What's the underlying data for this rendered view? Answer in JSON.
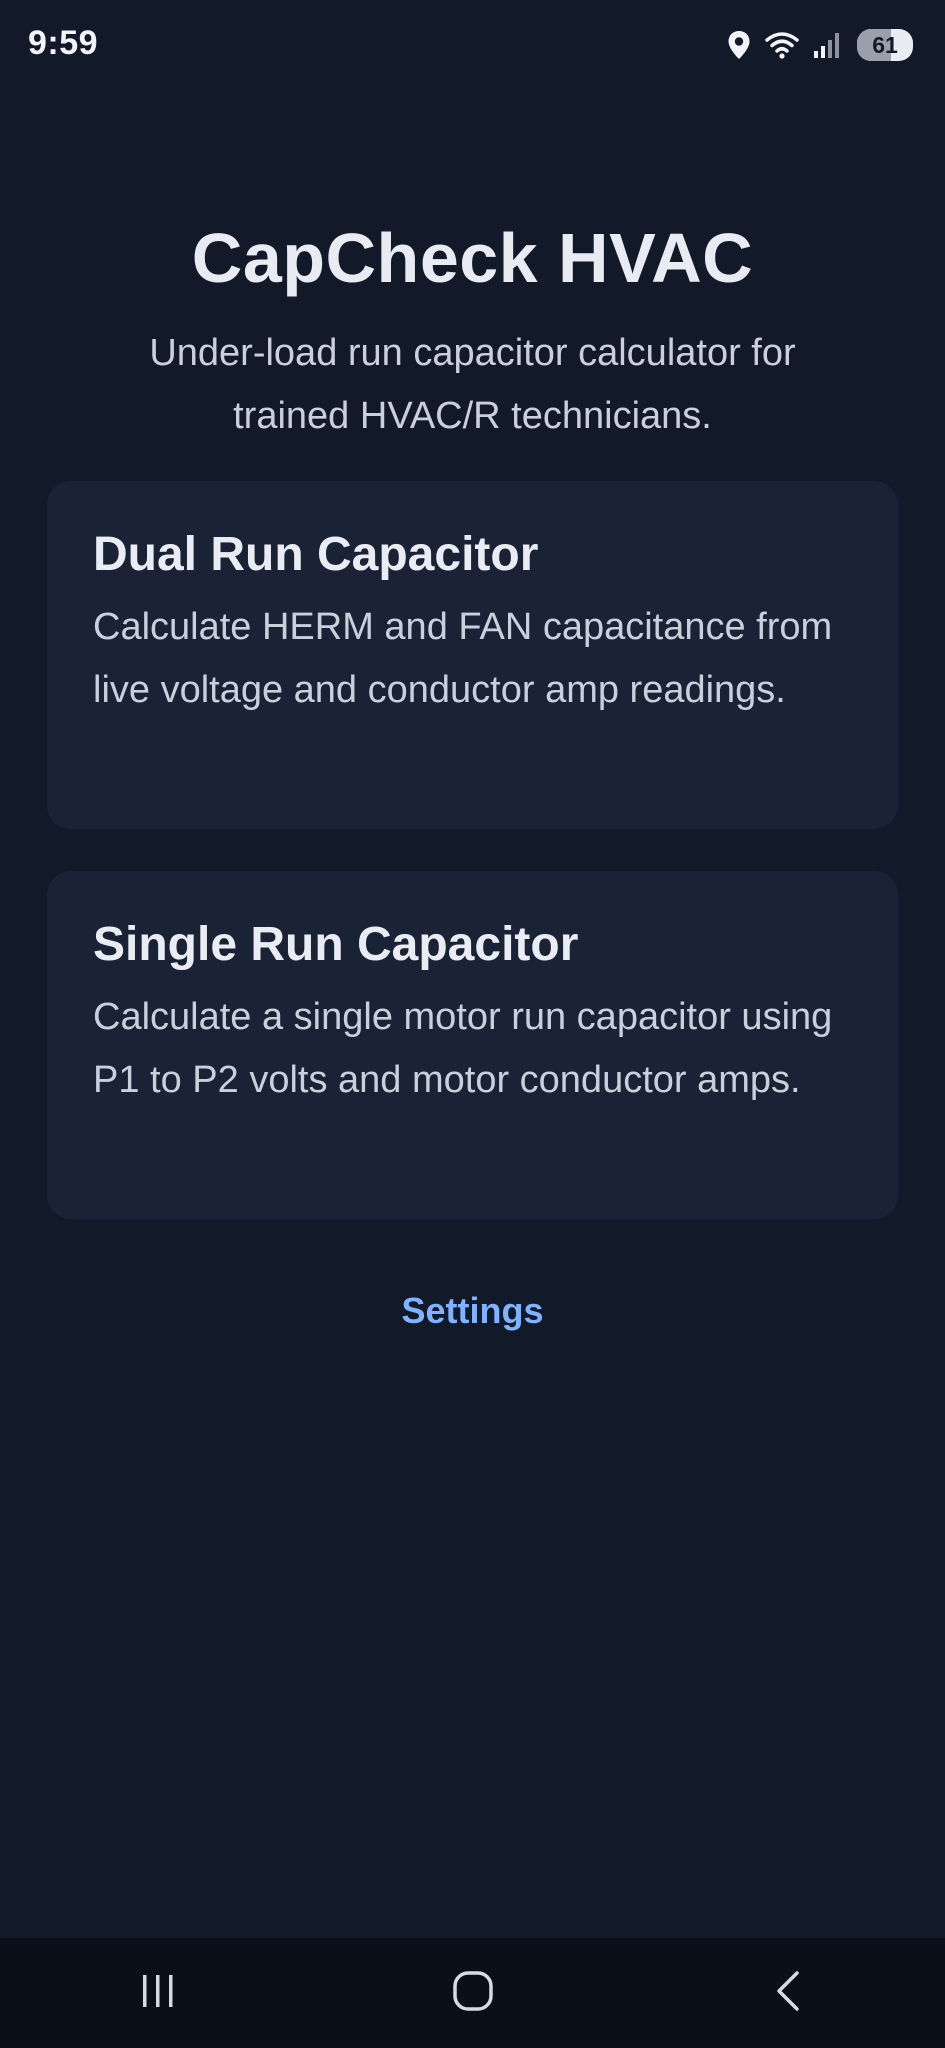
{
  "status_bar": {
    "time": "9:59",
    "icons": [
      "location-icon",
      "wifi-icon",
      "signal-icon",
      "battery-icon"
    ],
    "battery_level": "61"
  },
  "header": {
    "title": "CapCheck HVAC",
    "subtitle": "Under-load run capacitor calculator for trained HVAC/R technicians."
  },
  "cards": [
    {
      "title": "Dual Run Capacitor",
      "description": "Calculate HERM and FAN capacitance from live voltage and conductor amp readings."
    },
    {
      "title": "Single Run Capacitor",
      "description": "Calculate a single motor run capacitor using P1 to P2 volts and motor conductor amps."
    }
  ],
  "settings_label": "Settings",
  "nav_bar": {
    "icons": [
      "recent-apps-icon",
      "home-icon",
      "back-icon"
    ]
  },
  "colors": {
    "background": "#121929",
    "card_background": "#1a2336",
    "link": "#7fb3ff",
    "nav_background": "#0b0f1a"
  }
}
